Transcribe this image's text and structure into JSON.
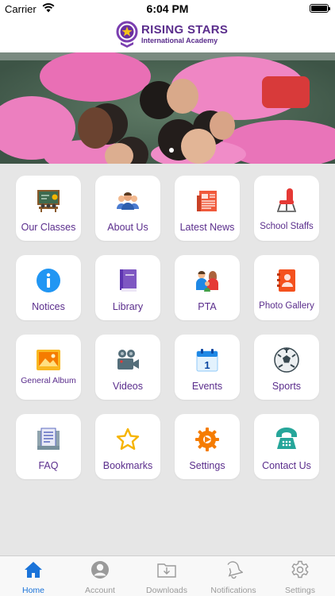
{
  "status_bar": {
    "carrier": "Carrier",
    "time": "6:04 PM"
  },
  "header": {
    "logo_title": "RISING STARS",
    "logo_subtitle": "International Academy"
  },
  "menu": [
    {
      "label": "Our Classes",
      "icon": "classroom-icon"
    },
    {
      "label": "About Us",
      "icon": "people-group-icon"
    },
    {
      "label": "Latest News",
      "icon": "newspaper-icon"
    },
    {
      "label": "School Staffs",
      "icon": "chair-icon"
    },
    {
      "label": "Notices",
      "icon": "info-icon"
    },
    {
      "label": "Library",
      "icon": "book-icon"
    },
    {
      "label": "PTA",
      "icon": "family-icon"
    },
    {
      "label": "Photo Gallery",
      "icon": "contact-book-icon"
    },
    {
      "label": "General Album",
      "icon": "image-icon"
    },
    {
      "label": "Videos",
      "icon": "video-camera-icon"
    },
    {
      "label": "Events",
      "icon": "calendar-icon"
    },
    {
      "label": "Sports",
      "icon": "soccer-ball-icon"
    },
    {
      "label": "FAQ",
      "icon": "document-icon"
    },
    {
      "label": "Bookmarks",
      "icon": "star-icon"
    },
    {
      "label": "Settings",
      "icon": "gear-icon"
    },
    {
      "label": "Contact Us",
      "icon": "telephone-icon"
    }
  ],
  "tabs": [
    {
      "label": "Home",
      "icon": "home-icon",
      "active": true
    },
    {
      "label": "Account",
      "icon": "account-icon",
      "active": false
    },
    {
      "label": "Downloads",
      "icon": "downloads-icon",
      "active": false
    },
    {
      "label": "Notifications",
      "icon": "bell-icon",
      "active": false
    },
    {
      "label": "Settings",
      "icon": "gear-icon",
      "active": false
    }
  ],
  "colors": {
    "label": "#5a2d8c",
    "active_tab": "#1a73d9",
    "inactive_tab": "#9a9a9a",
    "background": "#e6e6e6"
  }
}
